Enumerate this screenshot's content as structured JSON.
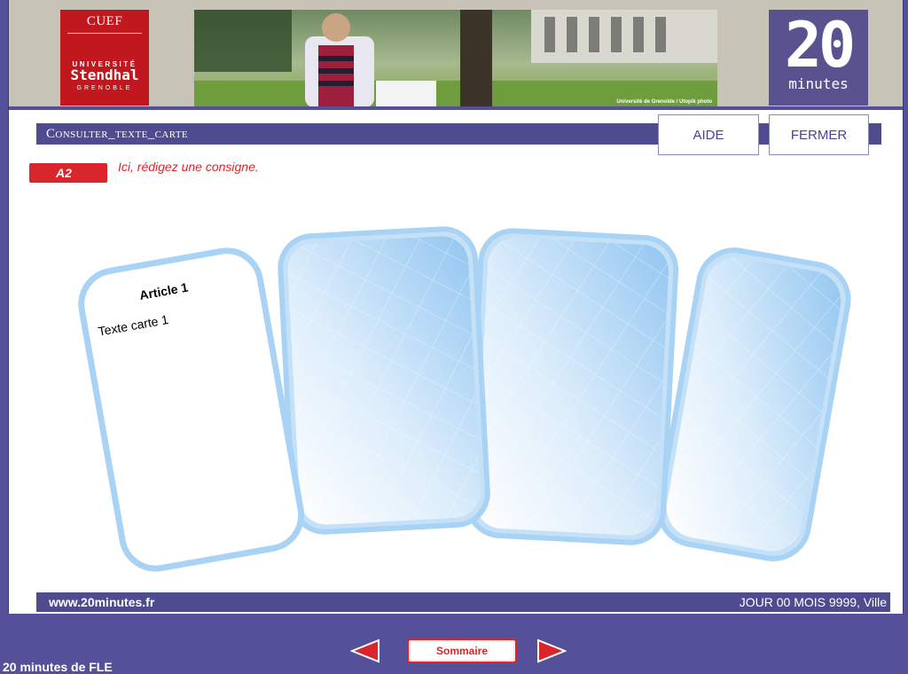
{
  "header": {
    "cuef": {
      "title": "CUEF",
      "line1": "UNIVERSITÉ",
      "line2": "Stendhal",
      "line3": "GRENOBLE"
    },
    "photo_credit": "Université de Grenoble / Utopik photo",
    "logo": {
      "big": "20",
      "small": "minutes"
    }
  },
  "title_bar": {
    "title": "Consulter_texte_carte"
  },
  "buttons": {
    "aide": "AIDE",
    "fermer": "FERMER"
  },
  "level_badge": "A2",
  "consigne": "Ici, rédigez une consigne.",
  "cards": [
    {
      "title": "Article 1",
      "text": "Texte carte 1"
    }
  ],
  "footer": {
    "url": "www.20minutes.fr",
    "date": "JOUR 00 MOIS 9999, Ville"
  },
  "nav": {
    "sommaire": "Sommaire"
  },
  "brand": "20 minutes de FLE",
  "colors": {
    "accent": "#d9262c",
    "brand_purple": "#55509a",
    "card_blue": "#a9d3f4"
  }
}
